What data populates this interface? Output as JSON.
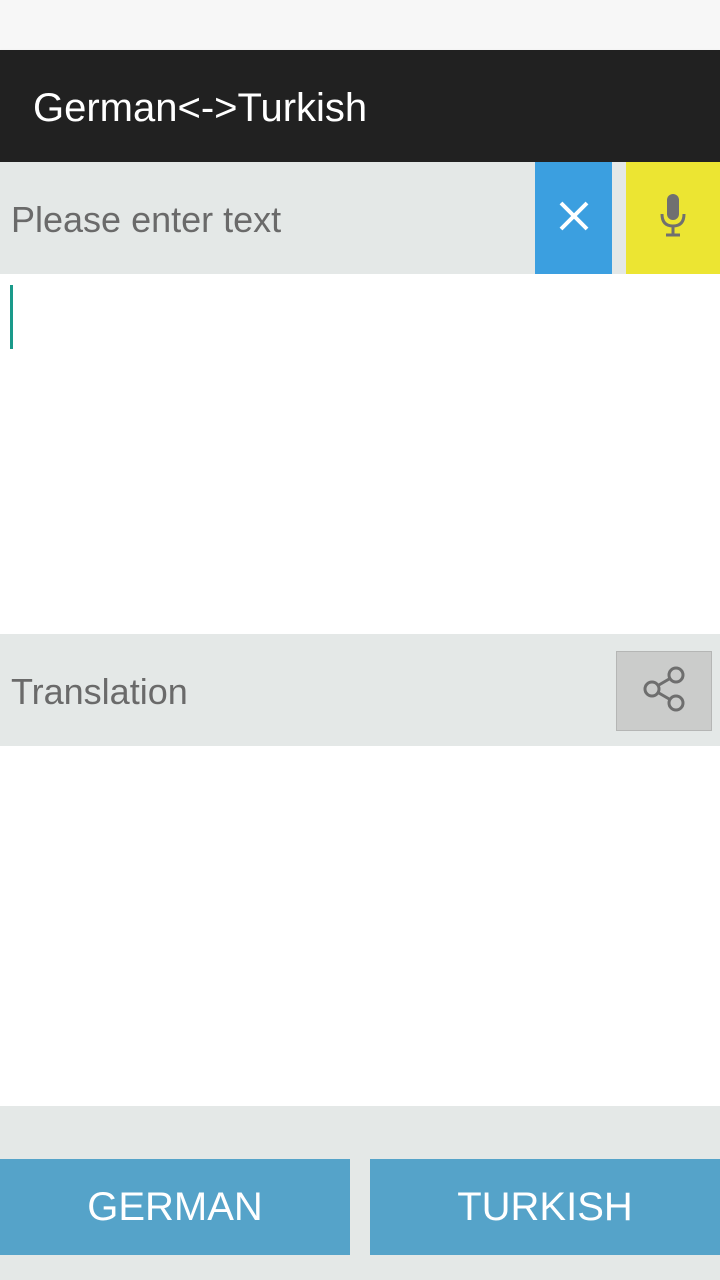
{
  "app_bar": {
    "title": "German<->Turkish"
  },
  "input": {
    "placeholder": "Please enter text",
    "value": "",
    "clear_icon": "close-icon",
    "mic_icon": "microphone-icon"
  },
  "translation": {
    "label": "Translation",
    "text": "",
    "share_icon": "share-icon"
  },
  "languages": {
    "source": "GERMAN",
    "target": "TURKISH"
  },
  "colors": {
    "app_bar": "#212121",
    "clear_button": "#3b9fe0",
    "mic_button": "#ece532",
    "language_button": "#55a3c9",
    "header_background": "#e4e8e7",
    "caret": "#1a9a8a"
  }
}
